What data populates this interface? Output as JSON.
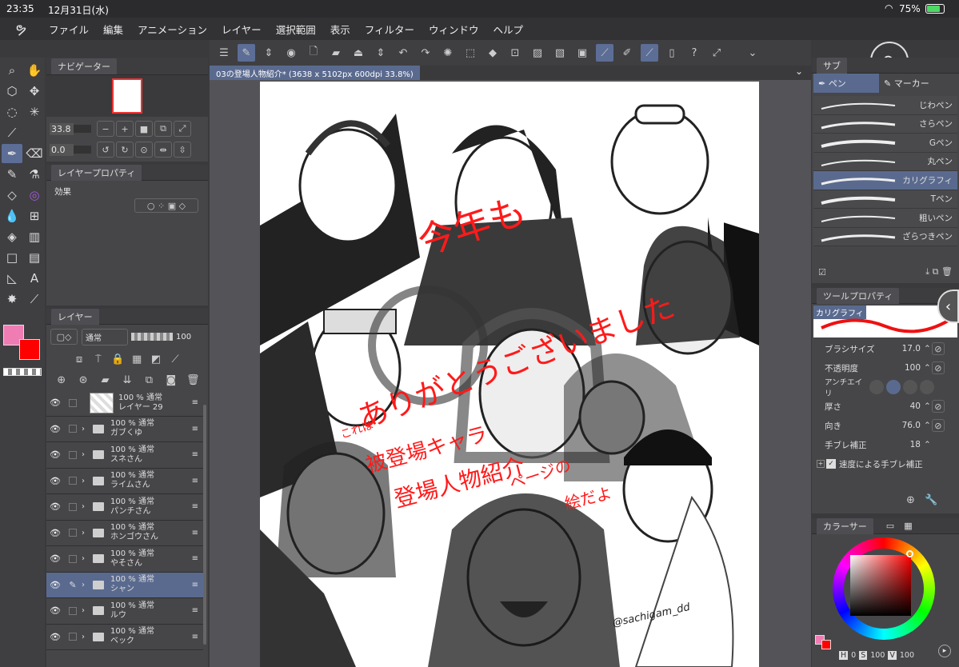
{
  "status": {
    "time": "23:35",
    "date": "12月31日(水)",
    "battery": "75%"
  },
  "menu": [
    "ファイル",
    "編集",
    "アニメーション",
    "レイヤー",
    "選択範囲",
    "表示",
    "フィルター",
    "ウィンドウ",
    "ヘルプ"
  ],
  "navigator": {
    "title": "ナビゲーター",
    "zoom": "33.8",
    "rotation": "0.0"
  },
  "layer_property": {
    "title": "レイヤープロパティ",
    "effect_label": "効果"
  },
  "layers_panel": {
    "title": "レイヤー",
    "blend_mode": "通常",
    "opacity": "100"
  },
  "layers": [
    {
      "pct": "100 %",
      "mode": "通常",
      "name": "レイヤー 29",
      "type": "raster"
    },
    {
      "pct": "100 %",
      "mode": "通常",
      "name": "ガブくゆ",
      "type": "folder"
    },
    {
      "pct": "100 %",
      "mode": "通常",
      "name": "スネさん",
      "type": "folder"
    },
    {
      "pct": "100 %",
      "mode": "通常",
      "name": "ライムさん",
      "type": "folder"
    },
    {
      "pct": "100 %",
      "mode": "通常",
      "name": "パンチさん",
      "type": "folder"
    },
    {
      "pct": "100 %",
      "mode": "通常",
      "name": "ホンゴウさん",
      "type": "folder"
    },
    {
      "pct": "100 %",
      "mode": "通常",
      "name": "やそさん",
      "type": "folder"
    },
    {
      "pct": "100 %",
      "mode": "通常",
      "name": "シャン",
      "type": "folder",
      "selected": true
    },
    {
      "pct": "100 %",
      "mode": "通常",
      "name": "ルウ",
      "type": "folder"
    },
    {
      "pct": "100 %",
      "mode": "通常",
      "name": "ベック",
      "type": "folder"
    }
  ],
  "document": {
    "tab_title": "03の登場人物紹介* (3638 x 5102px 600dpi 33.8%)"
  },
  "canvas_text": {
    "line1": "今年も",
    "line2": "ありがとうございました",
    "line3": "これは",
    "line4": "被登場キャラ",
    "line5": "登場人物紹介",
    "line6": "ページの",
    "line7": "絵だよ",
    "signature": "@sachigam_dd"
  },
  "subtool": {
    "title": "サブ",
    "tab_pen": "ペン",
    "tab_marker": "マーカー",
    "brushes": [
      "じわペン",
      "さらペン",
      "Gペン",
      "丸ペン",
      "カリグラフィ",
      "Tペン",
      "粗いペン",
      "ざらつきペン"
    ]
  },
  "tool_property": {
    "title": "ツールプロパティ",
    "tool_name": "カリグラフィ",
    "brush_size_label": "ブラシサイズ",
    "brush_size": "17.0",
    "opacity_label": "不透明度",
    "opacity": "100",
    "antialias_label": "アンチエイリ",
    "thickness_label": "厚さ",
    "thickness": "40",
    "direction_label": "向き",
    "direction": "76.0",
    "stabilization_label": "手ブレ補正",
    "stabilization": "18",
    "speed_label": "速度による手ブレ補正"
  },
  "color_panel": {
    "title": "カラーサー",
    "h_label": "H",
    "h": "0",
    "s_label": "S",
    "s": "100",
    "v_label": "V",
    "v": "100"
  },
  "colors": {
    "main": "#f07cb4",
    "sub": "#ff0000",
    "accent": "#5c6d96"
  }
}
